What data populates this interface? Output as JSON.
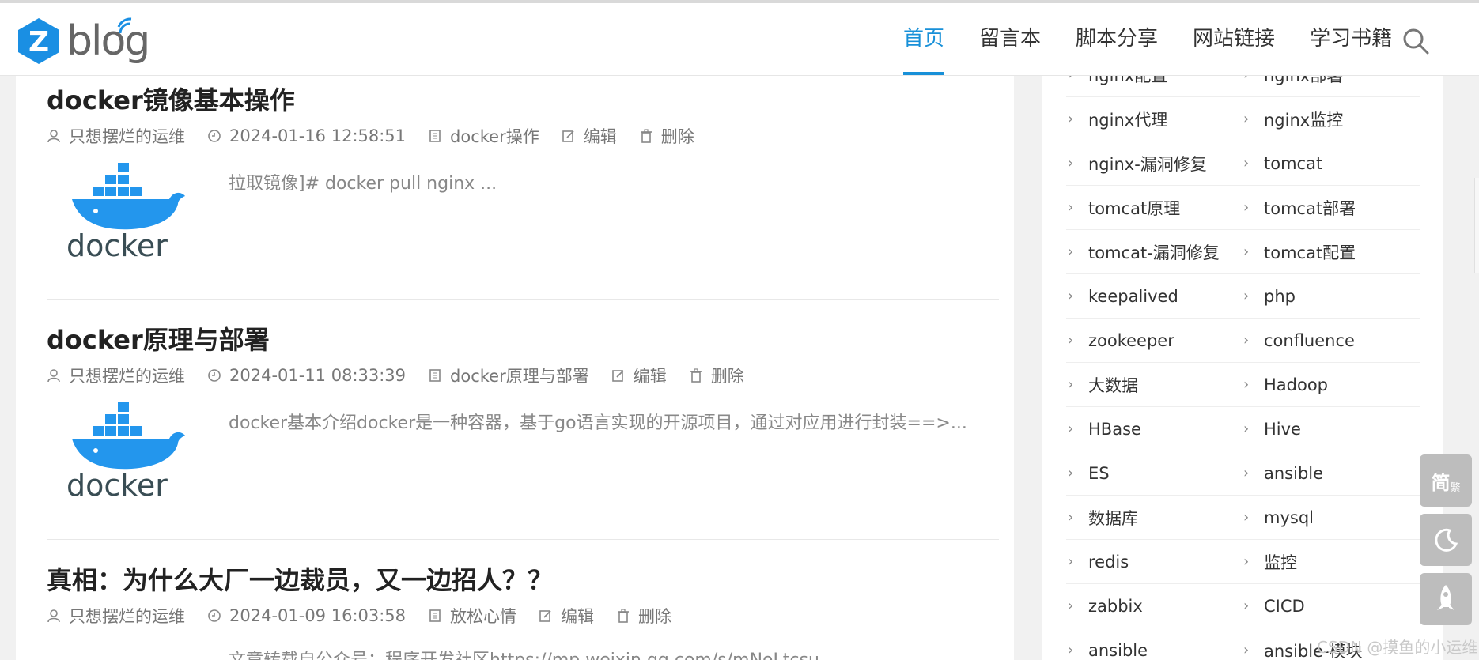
{
  "site": {
    "logo_text": "blog",
    "logo_mark": "Z"
  },
  "nav": {
    "items": [
      {
        "label": "首页",
        "active": true
      },
      {
        "label": "留言本",
        "active": false
      },
      {
        "label": "脚本分享",
        "active": false
      },
      {
        "label": "网站链接",
        "active": false
      },
      {
        "label": "学习书籍",
        "active": false
      }
    ],
    "search_icon": "search-icon"
  },
  "posts": [
    {
      "title": "docker镜像基本操作",
      "author": "只想摆烂的运维",
      "date": "2024-01-16 12:58:51",
      "category": "docker操作",
      "edit_label": "编辑",
      "delete_label": "删除",
      "summary": "拉取镜像]# docker pull nginx  ...",
      "thumb_text": "docker"
    },
    {
      "title": "docker原理与部署",
      "author": "只想摆烂的运维",
      "date": "2024-01-11 08:33:39",
      "category": "docker原理与部署",
      "edit_label": "编辑",
      "delete_label": "删除",
      "summary": "docker基本介绍docker是一种容器，基于go语言实现的开源项目，通过对应用进行封装==>...",
      "thumb_text": "docker"
    },
    {
      "title": "真相：为什么大厂一边裁员，又一边招人？？",
      "author": "只想摆烂的运维",
      "date": "2024-01-09 16:03:58",
      "category": "放松心情",
      "edit_label": "编辑",
      "delete_label": "删除",
      "summary": "文章转载自公众号：程序开发社区https://mp.weixin.qq.com/s/mNoLtcsu..."
    }
  ],
  "sidebar": {
    "tags": [
      [
        "nginx配置",
        "nginx部署"
      ],
      [
        "nginx代理",
        "nginx监控"
      ],
      [
        "nginx-漏洞修复",
        "tomcat"
      ],
      [
        "tomcat原理",
        "tomcat部署"
      ],
      [
        "tomcat-漏洞修复",
        "tomcat配置"
      ],
      [
        "keepalived",
        "php"
      ],
      [
        "zookeeper",
        "confluence"
      ],
      [
        "大数据",
        "Hadoop"
      ],
      [
        "HBase",
        "Hive"
      ],
      [
        "ES",
        "ansible"
      ],
      [
        "数据库",
        "mysql"
      ],
      [
        "redis",
        "监控"
      ],
      [
        "zabbix",
        "CICD"
      ],
      [
        "ansible",
        "ansible-模块"
      ]
    ]
  },
  "float_buttons": {
    "lang_label": "简",
    "lang_sub": "繁",
    "night_icon": "moon-icon",
    "top_icon": "rocket-icon"
  },
  "watermark": "CSDN @摸鱼的小运维",
  "colors": {
    "accent": "#1890d8",
    "logo_blue": "#1a8fe3",
    "docker_blue": "#2396ed"
  }
}
